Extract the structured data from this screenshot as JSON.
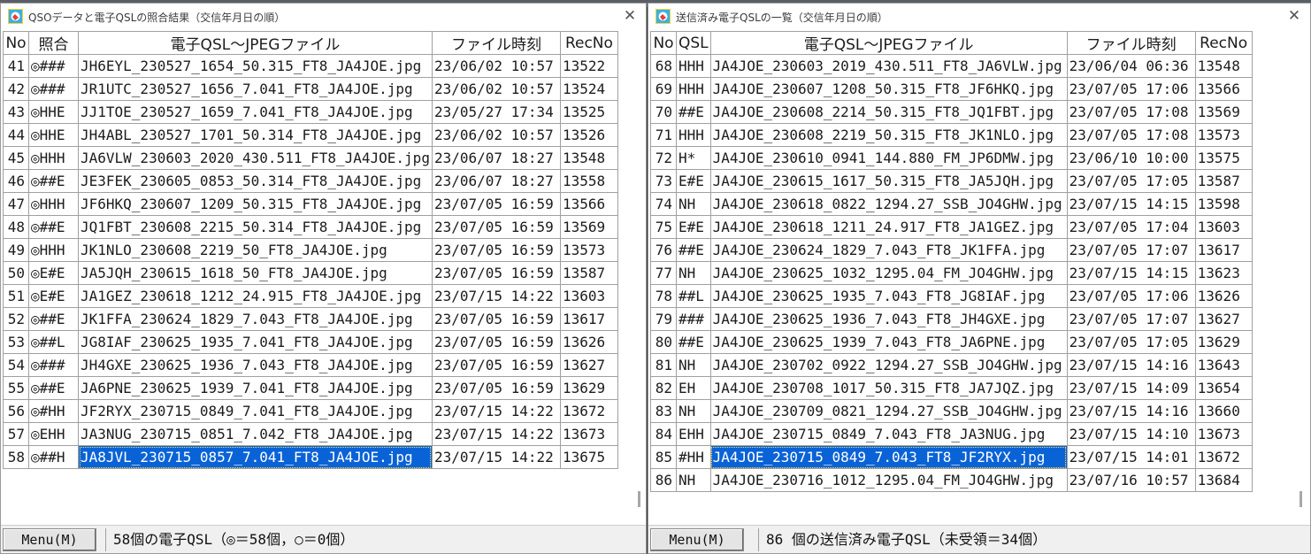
{
  "left": {
    "title": "QSOデータと電子QSLの照合結果（交信年月日の順）",
    "close_glyph": "✕",
    "columns": [
      "No",
      "照合",
      "電子QSL～JPEGファイル",
      "ファイル時刻",
      "RecNo"
    ],
    "rows": [
      [
        "41",
        "◎###",
        "JH6EYL_230527_1654_50.315_FT8_JA4JOE.jpg",
        "23/06/02 10:57",
        "13522"
      ],
      [
        "42",
        "◎###",
        "JR1UTC_230527_1656_7.041_FT8_JA4JOE.jpg",
        "23/06/02 10:57",
        "13524"
      ],
      [
        "43",
        "◎HHE",
        "JJ1TOE_230527_1659_7.041_FT8_JA4JOE.jpg",
        "23/05/27 17:34",
        "13525"
      ],
      [
        "44",
        "◎HHE",
        "JH4ABL_230527_1701_50.314_FT8_JA4JOE.jpg",
        "23/06/02 10:57",
        "13526"
      ],
      [
        "45",
        "◎HHH",
        "JA6VLW_230603_2020_430.511_FT8_JA4JOE.jpg",
        "23/06/07 18:27",
        "13548"
      ],
      [
        "46",
        "◎##E",
        "JE3FEK_230605_0853_50.314_FT8_JA4JOE.jpg",
        "23/06/07 18:27",
        "13558"
      ],
      [
        "47",
        "◎HHH",
        "JF6HKQ_230607_1209_50.315_FT8_JA4JOE.jpg",
        "23/07/05 16:59",
        "13566"
      ],
      [
        "48",
        "◎##E",
        "JQ1FBT_230608_2215_50.314_FT8_JA4JOE.jpg",
        "23/07/05 16:59",
        "13569"
      ],
      [
        "49",
        "◎HHH",
        "JK1NLO_230608_2219_50_FT8_JA4JOE.jpg",
        "23/07/05 16:59",
        "13573"
      ],
      [
        "50",
        "◎E#E",
        "JA5JQH_230615_1618_50_FT8_JA4JOE.jpg",
        "23/07/05 16:59",
        "13587"
      ],
      [
        "51",
        "◎E#E",
        "JA1GEZ_230618_1212_24.915_FT8_JA4JOE.jpg",
        "23/07/15 14:22",
        "13603"
      ],
      [
        "52",
        "◎##E",
        "JK1FFA_230624_1829_7.043_FT8_JA4JOE.jpg",
        "23/07/05 16:59",
        "13617"
      ],
      [
        "53",
        "◎##L",
        "JG8IAF_230625_1935_7.041_FT8_JA4JOE.jpg",
        "23/07/05 16:59",
        "13626"
      ],
      [
        "54",
        "◎###",
        "JH4GXE_230625_1936_7.043_FT8_JA4JOE.jpg",
        "23/07/05 16:59",
        "13627"
      ],
      [
        "55",
        "◎##E",
        "JA6PNE_230625_1939_7.041_FT8_JA4JOE.jpg",
        "23/07/05 16:59",
        "13629"
      ],
      [
        "56",
        "◎#HH",
        "JF2RYX_230715_0849_7.041_FT8_JA4JOE.jpg",
        "23/07/15 14:22",
        "13672"
      ],
      [
        "57",
        "◎EHH",
        "JA3NUG_230715_0851_7.042_FT8_JA4JOE.jpg",
        "23/07/15 14:22",
        "13673"
      ],
      [
        "58",
        "◎##H",
        "JA8JVL_230715_0857_7.041_FT8_JA4JOE.jpg",
        "23/07/15 14:22",
        "13675"
      ]
    ],
    "selected_row": "58",
    "menu_label": "Menu(M)",
    "status": "58個の電子QSL（◎＝58個，○＝0個）"
  },
  "right": {
    "title": "送信済み電子QSLの一覧（交信年月日の順）",
    "close_glyph": "✕",
    "columns": [
      "No",
      "QSL",
      "電子QSL～JPEGファイル",
      "ファイル時刻",
      "RecNo"
    ],
    "rows": [
      [
        "68",
        "HHH",
        "JA4JOE_230603_2019_430.511_FT8_JA6VLW.jpg",
        "23/06/04 06:36",
        "13548"
      ],
      [
        "69",
        "HHH",
        "JA4JOE_230607_1208_50.315_FT8_JF6HKQ.jpg",
        "23/07/05 17:06",
        "13566"
      ],
      [
        "70",
        "##E",
        "JA4JOE_230608_2214_50.315_FT8_JQ1FBT.jpg",
        "23/07/05 17:08",
        "13569"
      ],
      [
        "71",
        "HHH",
        "JA4JOE_230608_2219_50.315_FT8_JK1NLO.jpg",
        "23/07/05 17:08",
        "13573"
      ],
      [
        "72",
        "H*",
        "JA4JOE_230610_0941_144.880_FM_JP6DMW.jpg",
        "23/06/10 10:00",
        "13575"
      ],
      [
        "73",
        "E#E",
        "JA4JOE_230615_1617_50.315_FT8_JA5JQH.jpg",
        "23/07/05 17:05",
        "13587"
      ],
      [
        "74",
        "NH",
        "JA4JOE_230618_0822_1294.27_SSB_JO4GHW.jpg",
        "23/07/15 14:15",
        "13598"
      ],
      [
        "75",
        "E#E",
        "JA4JOE_230618_1211_24.917_FT8_JA1GEZ.jpg",
        "23/07/05 17:04",
        "13603"
      ],
      [
        "76",
        "##E",
        "JA4JOE_230624_1829_7.043_FT8_JK1FFA.jpg",
        "23/07/05 17:07",
        "13617"
      ],
      [
        "77",
        "NH",
        "JA4JOE_230625_1032_1295.04_FM_JO4GHW.jpg",
        "23/07/15 14:15",
        "13623"
      ],
      [
        "78",
        "##L",
        "JA4JOE_230625_1935_7.043_FT8_JG8IAF.jpg",
        "23/07/05 17:06",
        "13626"
      ],
      [
        "79",
        "###",
        "JA4JOE_230625_1936_7.043_FT8_JH4GXE.jpg",
        "23/07/05 17:07",
        "13627"
      ],
      [
        "80",
        "##E",
        "JA4JOE_230625_1939_7.043_FT8_JA6PNE.jpg",
        "23/07/05 17:05",
        "13629"
      ],
      [
        "81",
        "NH",
        "JA4JOE_230702_0922_1294.27_SSB_JO4GHW.jpg",
        "23/07/15 14:16",
        "13643"
      ],
      [
        "82",
        "EH",
        "JA4JOE_230708_1017_50.315_FT8_JA7JQZ.jpg",
        "23/07/15 14:09",
        "13654"
      ],
      [
        "83",
        "NH",
        "JA4JOE_230709_0821_1294.27_SSB_JO4GHW.jpg",
        "23/07/15 14:16",
        "13660"
      ],
      [
        "84",
        "EHH",
        "JA4JOE_230715_0849_7.043_FT8_JA3NUG.jpg",
        "23/07/15 14:10",
        "13673"
      ],
      [
        "85",
        "#HH",
        "JA4JOE_230715_0849_7.043_FT8_JF2RYX.jpg",
        "23/07/15 14:01",
        "13672"
      ],
      [
        "86",
        "NH",
        "JA4JOE_230716_1012_1295.04_FM_JO4GHW.jpg",
        "23/07/16 10:57",
        "13684"
      ]
    ],
    "selected_row": "85",
    "menu_label": "Menu(M)",
    "status": "86 個の送信済み電子QSL（未受領＝34個）"
  },
  "colors": {
    "selection": "#0a63d6",
    "grid_line": "#a0a0a0",
    "status_bg": "#f0f0f0"
  },
  "icons": {
    "app": "app-logo-icon",
    "close": "close-icon"
  }
}
